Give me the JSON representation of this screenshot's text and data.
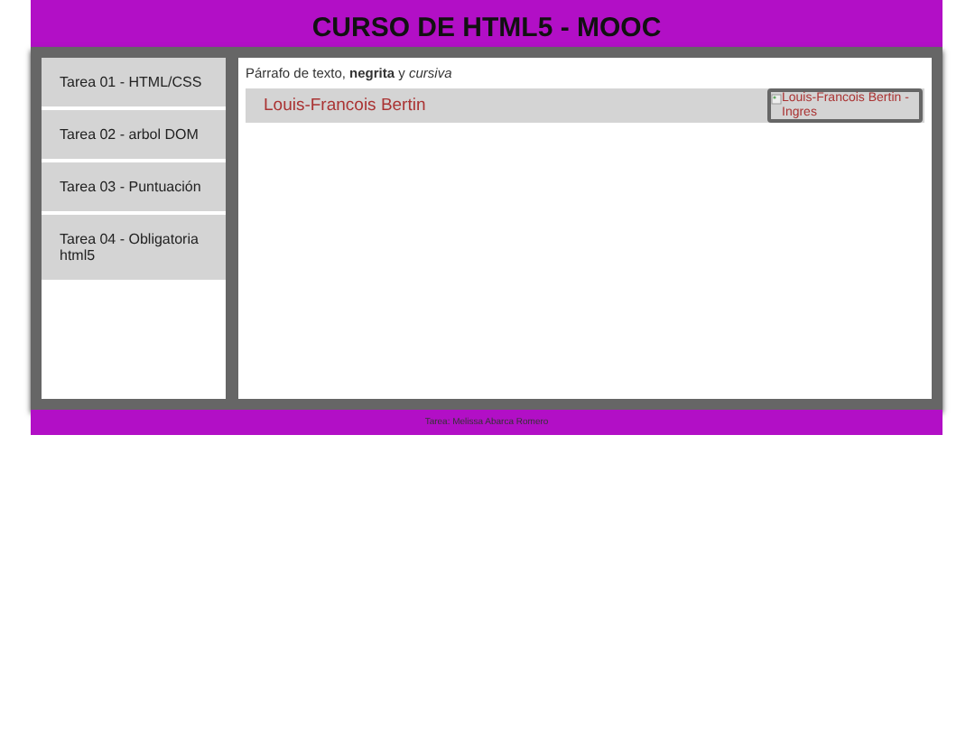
{
  "header": {
    "title": "CURSO DE HTML5 - MOOC"
  },
  "sidebar": {
    "items": [
      {
        "label": "Tarea 01 - HTML/CSS"
      },
      {
        "label": "Tarea 02 - arbol DOM"
      },
      {
        "label": "Tarea 03 - Puntuación"
      },
      {
        "label": "Tarea 04 - Obligatoria html5"
      }
    ]
  },
  "content": {
    "paragraph": "Párrafo de texto, **negrita** y *cursiva*",
    "figure": {
      "caption": "Louis-Francois Bertin",
      "image_alt": "Louis-Francois Bertin - Ingres"
    }
  },
  "footer": {
    "text": "Tarea: Melissa Abarca Romero"
  }
}
